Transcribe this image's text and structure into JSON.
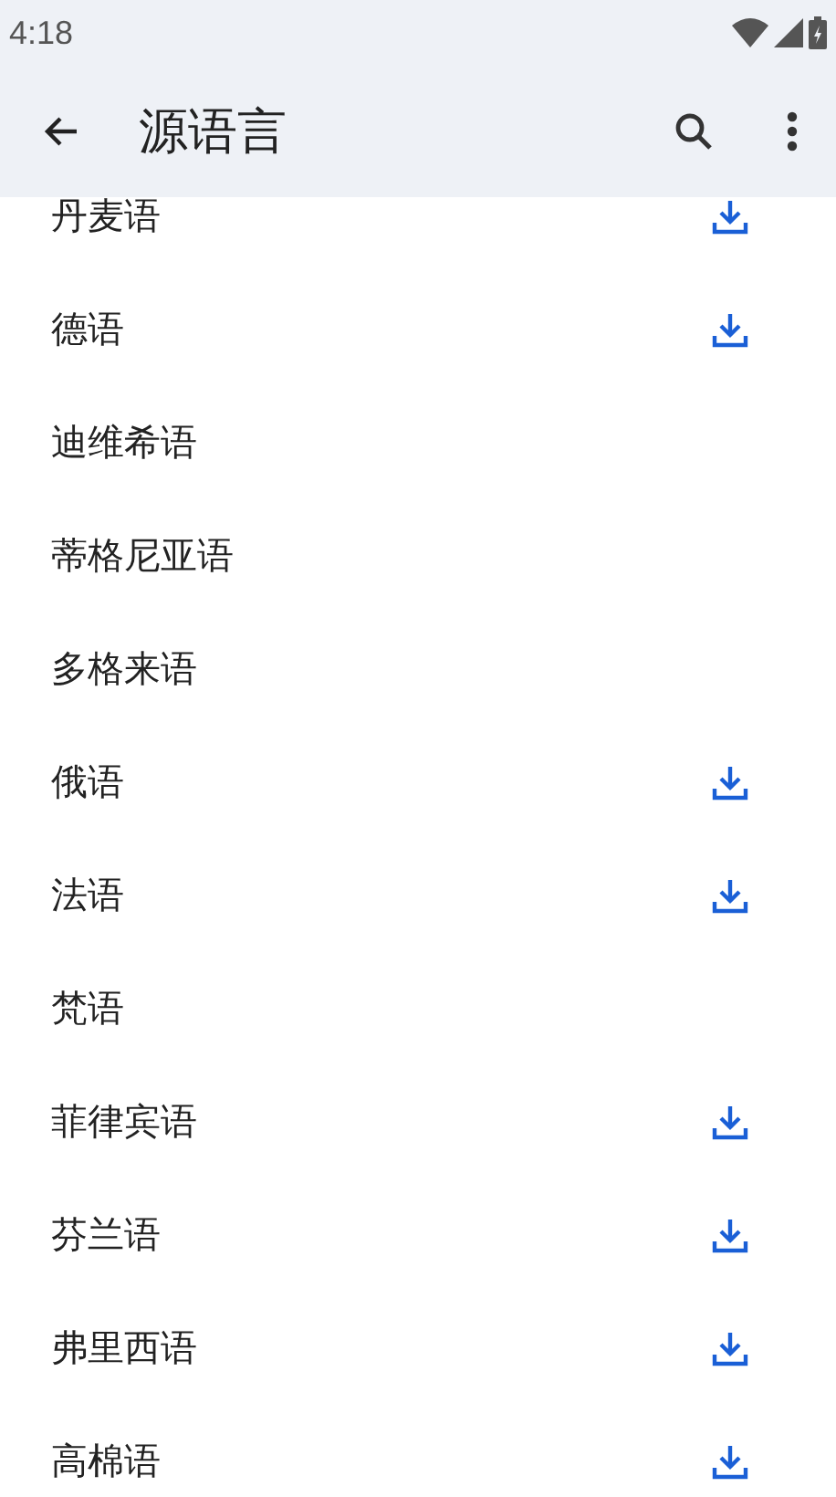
{
  "status_bar": {
    "time": "4:18"
  },
  "app_bar": {
    "title": "源语言"
  },
  "languages": [
    {
      "name": "丹麦语",
      "downloadable": true
    },
    {
      "name": "德语",
      "downloadable": true
    },
    {
      "name": "迪维希语",
      "downloadable": false
    },
    {
      "name": "蒂格尼亚语",
      "downloadable": false
    },
    {
      "name": "多格来语",
      "downloadable": false
    },
    {
      "name": "俄语",
      "downloadable": true
    },
    {
      "name": "法语",
      "downloadable": true
    },
    {
      "name": "梵语",
      "downloadable": false
    },
    {
      "name": "菲律宾语",
      "downloadable": true
    },
    {
      "name": "芬兰语",
      "downloadable": true
    },
    {
      "name": "弗里西语",
      "downloadable": true
    },
    {
      "name": "高棉语",
      "downloadable": true
    }
  ]
}
